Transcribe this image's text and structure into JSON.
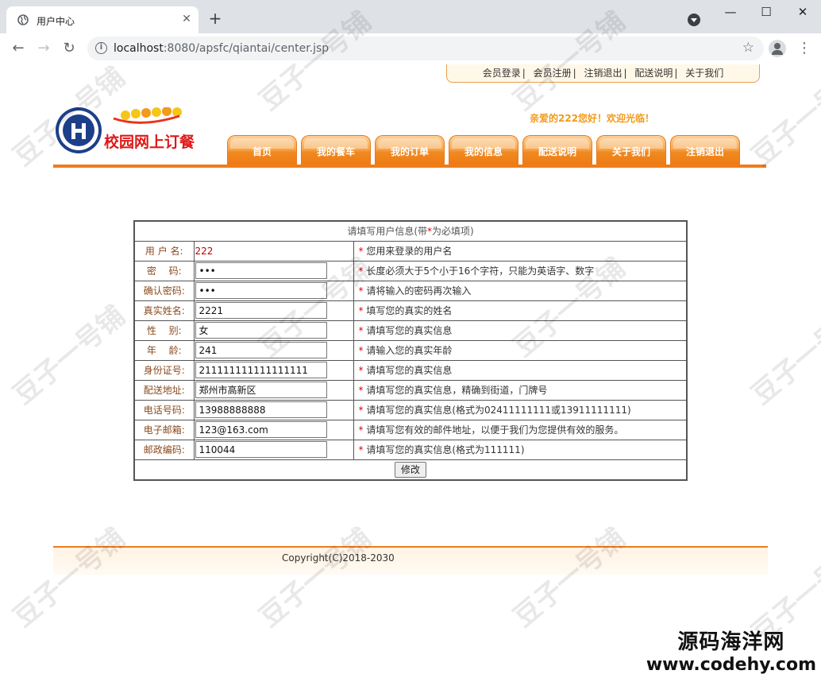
{
  "browser": {
    "tab_title": "用户中心",
    "url_host": "localhost",
    "url_rest": ":8080/apsfc/qiantai/center.jsp"
  },
  "top_links": [
    "会员登录",
    "会员注册",
    "注销退出",
    "配送说明",
    "关于我们"
  ],
  "logo_text": "校园网上订餐",
  "welcome": "亲爱的222您好！欢迎光临！",
  "nav_tabs": [
    "首页",
    "我的餐车",
    "我的订单",
    "我的信息",
    "配送说明",
    "关于我们",
    "注销退出"
  ],
  "form": {
    "heading_pre": "请填写用户信息(带",
    "heading_star": "*",
    "heading_post": "为必填项)",
    "username_label": "用 户 名:",
    "username_value": "222",
    "username_hint": "您用来登录的用户名",
    "rows": [
      {
        "label": "密　 码:",
        "value": "•••",
        "hint": "长度必须大于5个小于16个字符，只能为英语字、数字"
      },
      {
        "label": "确认密码:",
        "value": "•••",
        "hint": "请将输入的密码再次输入"
      },
      {
        "label": "真实姓名:",
        "value": "2221",
        "hint": "填写您的真实的姓名"
      },
      {
        "label": "性　 别:",
        "value": "女",
        "hint": "请填写您的真实信息"
      },
      {
        "label": "年　 龄:",
        "value": "241",
        "hint": "请输入您的真实年龄"
      },
      {
        "label": "身份证号:",
        "value": "211111111111111111",
        "hint": "请填写您的真实信息"
      },
      {
        "label": "配送地址:",
        "value": "郑州市高新区",
        "hint": "请填写您的真实信息，精确到街道，门牌号"
      },
      {
        "label": "电话号码:",
        "value": "13988888888",
        "hint": "请填写您的真实信息(格式为02411111111或13911111111)"
      },
      {
        "label": "电子邮箱:",
        "value": "123@163.com",
        "hint": "请填写您有效的邮件地址，以便于我们为您提供有效的服务。"
      },
      {
        "label": "邮政编码:",
        "value": "110044",
        "hint": "请填写您的真实信息(格式为111111)"
      }
    ],
    "submit_label": "修改"
  },
  "footer": {
    "copyright": "Copyright(C)2018-2030"
  },
  "watermark": {
    "text": "豆子一号铺",
    "brand_cn": "源码海洋网",
    "brand_en": "www.codehy.com"
  }
}
